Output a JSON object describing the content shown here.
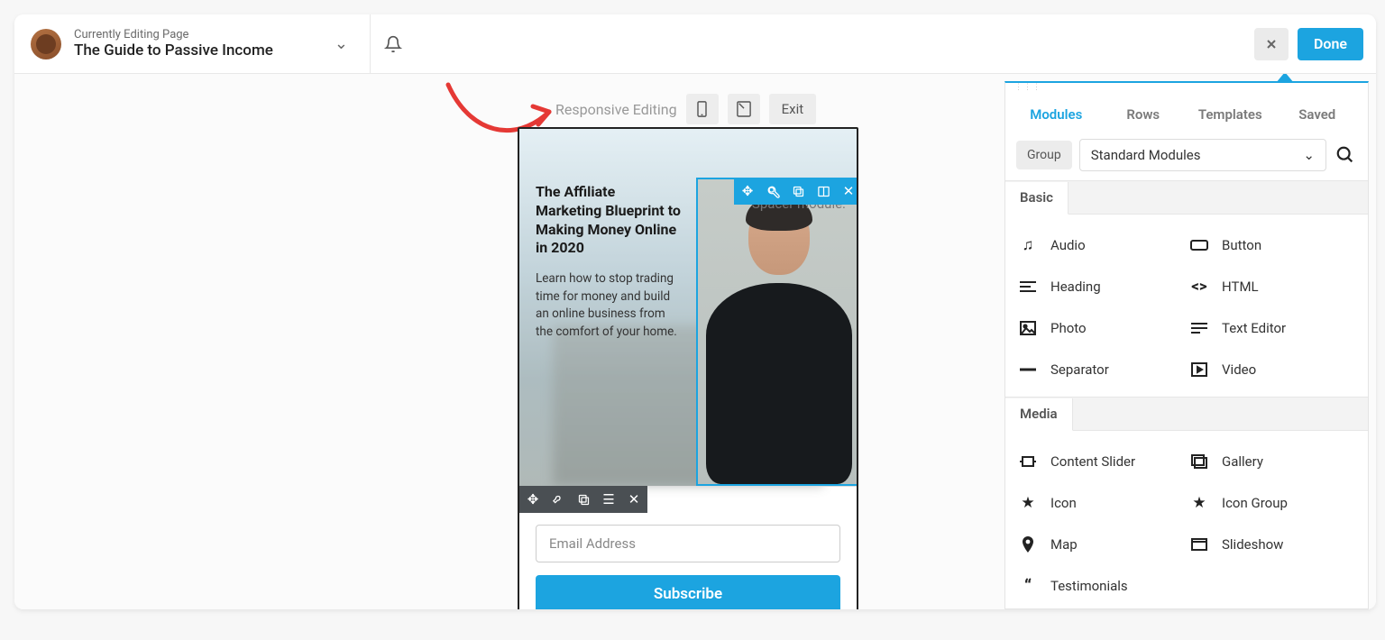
{
  "header": {
    "editing_label": "Currently Editing Page",
    "page_title": "The Guide to Passive Income"
  },
  "top_actions": {
    "done": "Done"
  },
  "responsive": {
    "label": "Responsive Editing",
    "exit": "Exit"
  },
  "preview": {
    "hero_title": "The Affiliate Marketing Blueprint to Making Money Online in 2020",
    "hero_sub": "Learn how to stop trading time for money and build an online business from the comfort of your home.",
    "spacer_hint": "Spacer module.",
    "email_placeholder": "Email Address",
    "subscribe": "Subscribe"
  },
  "panel": {
    "tabs": [
      "Modules",
      "Rows",
      "Templates",
      "Saved"
    ],
    "active_tab": 0,
    "group_label": "Group",
    "dropdown_value": "Standard Modules",
    "categories": {
      "basic": {
        "title": "Basic",
        "items": [
          {
            "icon": "audio",
            "label": "Audio"
          },
          {
            "icon": "button",
            "label": "Button"
          },
          {
            "icon": "heading",
            "label": "Heading"
          },
          {
            "icon": "html",
            "label": "HTML"
          },
          {
            "icon": "photo",
            "label": "Photo"
          },
          {
            "icon": "text",
            "label": "Text Editor"
          },
          {
            "icon": "separator",
            "label": "Separator"
          },
          {
            "icon": "video",
            "label": "Video"
          }
        ]
      },
      "media": {
        "title": "Media",
        "items": [
          {
            "icon": "slider",
            "label": "Content Slider"
          },
          {
            "icon": "gallery",
            "label": "Gallery"
          },
          {
            "icon": "icon",
            "label": "Icon"
          },
          {
            "icon": "icongroup",
            "label": "Icon Group"
          },
          {
            "icon": "map",
            "label": "Map"
          },
          {
            "icon": "slideshow",
            "label": "Slideshow"
          },
          {
            "icon": "testimonials",
            "label": "Testimonials"
          }
        ]
      }
    }
  }
}
